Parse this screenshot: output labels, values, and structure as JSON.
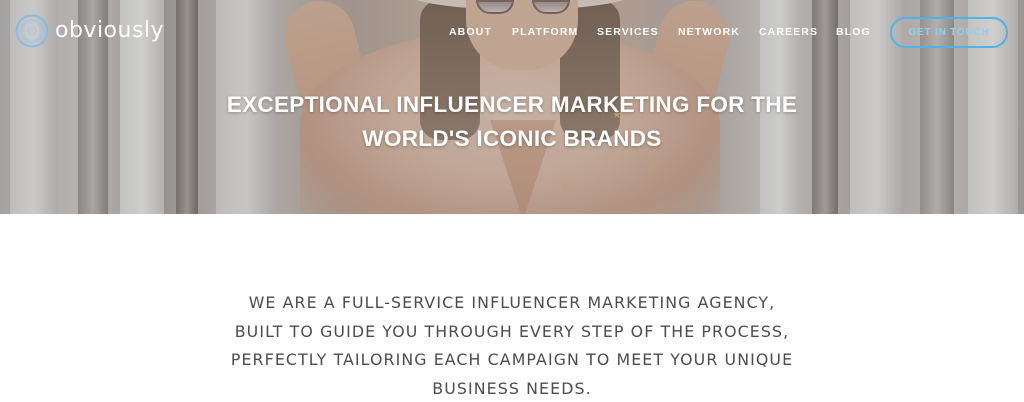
{
  "brand": {
    "name": "obviously",
    "logo_icon": "concentric-circles-icon",
    "logo_color": "#8ab8e0"
  },
  "nav": {
    "items": [
      {
        "label": "ABOUT"
      },
      {
        "label": "PLATFORM"
      },
      {
        "label": "SERVICES"
      },
      {
        "label": "NETWORK"
      },
      {
        "label": "CAREERS"
      },
      {
        "label": "BLOG"
      }
    ],
    "cta_label": "GET IN TOUCH",
    "cta_color": "#4fb3e8"
  },
  "hero": {
    "title_lines": [
      "EXCEPTIONAL INFLUENCER MARKETING FOR THE",
      "WORLD'S ICONIC BRANDS"
    ]
  },
  "intro": {
    "lines": [
      "WE ARE A FULL-SERVICE INFLUENCER MARKETING AGENCY,",
      "BUILT TO GUIDE YOU THROUGH EVERY STEP OF THE PROCESS,",
      "PERFECTLY TAILORING EACH CAMPAIGN TO MEET YOUR UNIQUE",
      "BUSINESS NEEDS."
    ],
    "text_color": "#4d4d4d"
  }
}
